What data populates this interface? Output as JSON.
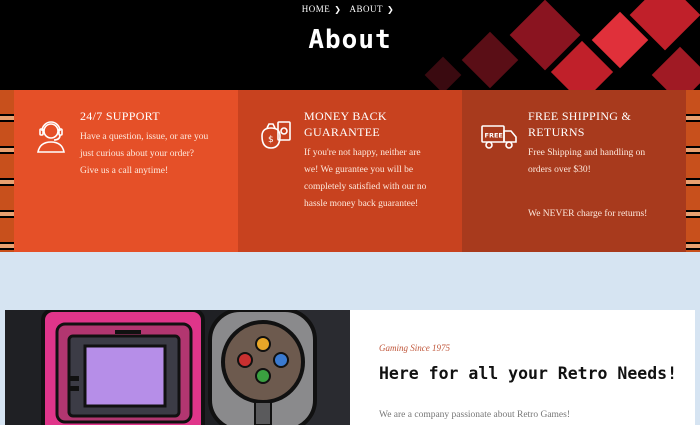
{
  "breadcrumb": {
    "home": "HOME",
    "about": "ABOUT"
  },
  "hero": {
    "title": "About"
  },
  "features": [
    {
      "icon": "headset-support-icon",
      "title": "24/7 SUPPORT",
      "text": [
        "Have a question, issue, or are you",
        "just curious about your order?",
        "Give us a call anytime!"
      ]
    },
    {
      "icon": "money-bag-icon",
      "title_line1": "MONEY BACK",
      "title_line2": "GUARANTEE",
      "text": [
        "If you're not happy, neither are",
        "we! We gurantee you will be",
        "completely satisfied with our no",
        "hassle money back guarantee!"
      ]
    },
    {
      "icon": "free-shipping-truck-icon",
      "icon_label": "FREE",
      "title_line1": "FREE SHIPPING &",
      "title_line2": "RETURNS",
      "text": [
        "Free Shipping and handling on",
        "orders over $30!"
      ],
      "extra": "We NEVER charge for returns!"
    }
  ],
  "about": {
    "eyebrow": "Gaming Since 1975",
    "heading": "Here for all your Retro Needs!",
    "text": "We are a company passionate about Retro Games!"
  },
  "colors": {
    "accent": "#e55028",
    "hero_bg": "#000000",
    "page_bg": "#d6e4f2"
  }
}
